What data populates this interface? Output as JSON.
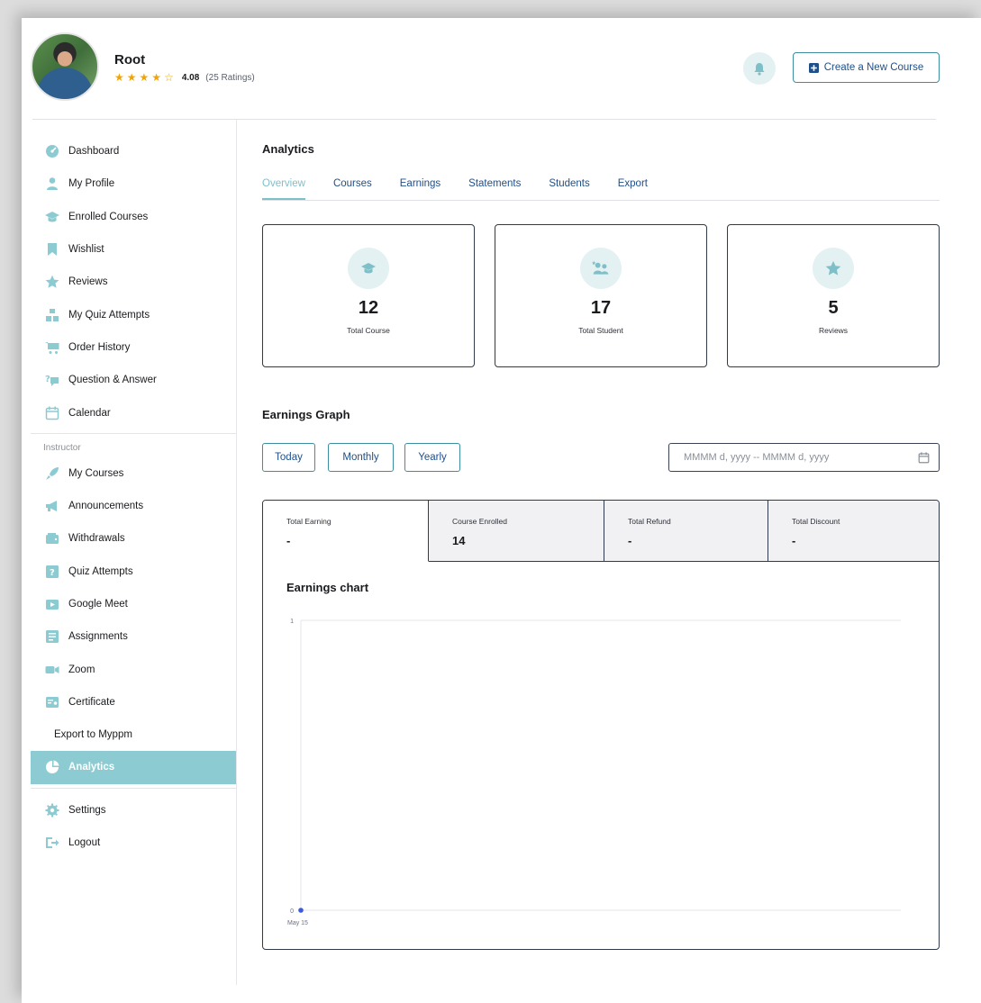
{
  "header": {
    "user_name": "Root",
    "rating_stars": 4.08,
    "rating_value": "4.08",
    "rating_count": "(25 Ratings)",
    "create_button_label": "Create a New Course"
  },
  "sidebar": {
    "items": [
      {
        "label": "Dashboard",
        "icon": "dashboard-icon"
      },
      {
        "label": "My Profile",
        "icon": "user-icon"
      },
      {
        "label": "Enrolled Courses",
        "icon": "graduation-cap-icon"
      },
      {
        "label": "Wishlist",
        "icon": "bookmark-icon"
      },
      {
        "label": "Reviews",
        "icon": "star-icon"
      },
      {
        "label": "My Quiz Attempts",
        "icon": "quiz-icon"
      },
      {
        "label": "Order History",
        "icon": "cart-icon"
      },
      {
        "label": "Question & Answer",
        "icon": "question-answer-icon"
      },
      {
        "label": "Calendar",
        "icon": "calendar-icon"
      }
    ],
    "instructor_section_label": "Instructor",
    "instructor_items": [
      {
        "label": "My Courses",
        "icon": "rocket-icon"
      },
      {
        "label": "Announcements",
        "icon": "megaphone-icon"
      },
      {
        "label": "Withdrawals",
        "icon": "wallet-icon"
      },
      {
        "label": "Quiz Attempts",
        "icon": "quiz-attempt-icon"
      },
      {
        "label": "Google Meet",
        "icon": "video-icon"
      },
      {
        "label": "Assignments",
        "icon": "assignment-icon"
      },
      {
        "label": "Zoom",
        "icon": "zoom-icon"
      },
      {
        "label": "Certificate",
        "icon": "certificate-icon"
      },
      {
        "label": "Export to Myppm",
        "icon": ""
      },
      {
        "label": "Analytics",
        "icon": "pie-chart-icon"
      }
    ],
    "bottom_items": [
      {
        "label": "Settings",
        "icon": "gear-icon"
      },
      {
        "label": "Logout",
        "icon": "logout-icon"
      }
    ]
  },
  "main": {
    "title": "Analytics",
    "tabs": [
      "Overview",
      "Courses",
      "Earnings",
      "Statements",
      "Students",
      "Export"
    ],
    "active_tab": "Overview",
    "stats": [
      {
        "value": "12",
        "label": "Total Course",
        "icon": "graduation-cap-icon"
      },
      {
        "value": "17",
        "label": "Total Student",
        "icon": "students-icon"
      },
      {
        "value": "5",
        "label": "Reviews",
        "icon": "star-icon"
      }
    ],
    "graph_title": "Earnings Graph",
    "range_buttons": [
      "Today",
      "Monthly",
      "Yearly"
    ],
    "date_placeholder": "MMMM d, yyyy -- MMMM d, yyyy",
    "summary": [
      {
        "label": "Total Earning",
        "value": "-"
      },
      {
        "label": "Course Enrolled",
        "value": "14"
      },
      {
        "label": "Total Refund",
        "value": "-"
      },
      {
        "label": "Total Discount",
        "value": "-"
      }
    ],
    "chart_title": "Earnings chart"
  },
  "colors": {
    "accent": "#8ccbd2",
    "link_blue": "#1f4f8a",
    "icon_tint": "#e3f1f3",
    "star": "#f4a400",
    "chart_point": "#3b5bdb"
  },
  "chart_data": {
    "type": "line",
    "title": "Earnings chart",
    "x": [
      "May 15"
    ],
    "series": [
      {
        "values": [
          0
        ]
      }
    ],
    "ylim": [
      0,
      1
    ],
    "yticks": [
      "0",
      "1"
    ],
    "grid": true
  }
}
